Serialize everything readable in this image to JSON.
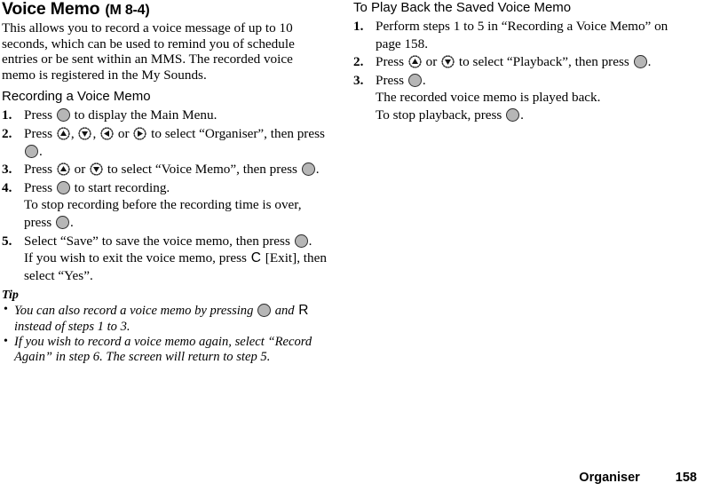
{
  "page": {
    "title": "Voice Memo",
    "title_suffix": "(M 8-4)",
    "intro": "This allows you to record a voice message of up to 10 seconds, which can be used to remind you of schedule entries or be sent within an MMS. The recorded voice memo is registered in the My Sounds."
  },
  "left_column": {
    "section_heading": "Recording a Voice Memo",
    "steps": [
      {
        "num": "1.",
        "parts": [
          {
            "t": "text",
            "v": "Press "
          },
          {
            "t": "key",
            "v": "center-key"
          },
          {
            "t": "text",
            "v": " to display the Main Menu."
          }
        ]
      },
      {
        "num": "2.",
        "parts": [
          {
            "t": "text",
            "v": "Press "
          },
          {
            "t": "key",
            "v": "up-key"
          },
          {
            "t": "text",
            "v": ", "
          },
          {
            "t": "key",
            "v": "down-key"
          },
          {
            "t": "text",
            "v": ", "
          },
          {
            "t": "key",
            "v": "left-key"
          },
          {
            "t": "text",
            "v": " or "
          },
          {
            "t": "key",
            "v": "right-key"
          },
          {
            "t": "text",
            "v": " to select “Organiser”, then press "
          },
          {
            "t": "key",
            "v": "center-key"
          },
          {
            "t": "text",
            "v": "."
          }
        ]
      },
      {
        "num": "3.",
        "parts": [
          {
            "t": "text",
            "v": "Press "
          },
          {
            "t": "key",
            "v": "up-key"
          },
          {
            "t": "text",
            "v": " or "
          },
          {
            "t": "key",
            "v": "down-key"
          },
          {
            "t": "text",
            "v": " to select “Voice Memo”, then press "
          },
          {
            "t": "key",
            "v": "center-key"
          },
          {
            "t": "text",
            "v": "."
          }
        ]
      },
      {
        "num": "4.",
        "parts": [
          {
            "t": "text",
            "v": "Press "
          },
          {
            "t": "key",
            "v": "center-key"
          },
          {
            "t": "text",
            "v": " to start recording."
          },
          {
            "t": "br"
          },
          {
            "t": "text",
            "v": "To stop recording before the recording time is over, press "
          },
          {
            "t": "key",
            "v": "center-key"
          },
          {
            "t": "text",
            "v": "."
          }
        ]
      },
      {
        "num": "5.",
        "parts": [
          {
            "t": "text",
            "v": "Select “Save” to save the voice memo, then press "
          },
          {
            "t": "key",
            "v": "center-key"
          },
          {
            "t": "text",
            "v": "."
          },
          {
            "t": "br"
          },
          {
            "t": "text",
            "v": "If you wish to exit the voice memo, press "
          },
          {
            "t": "key",
            "v": "C"
          },
          {
            "t": "text",
            "v": " [Exit], then select “Yes”."
          }
        ]
      }
    ],
    "tip_heading": "Tip",
    "tips": [
      {
        "bullet": "•",
        "parts": [
          {
            "t": "text",
            "v": "You can also record a voice memo by pressing "
          },
          {
            "t": "key",
            "v": "center-key"
          },
          {
            "t": "text",
            "v": " and "
          },
          {
            "t": "key",
            "v": "R"
          },
          {
            "t": "text",
            "v": " instead of steps 1 to 3."
          }
        ]
      },
      {
        "bullet": "•",
        "parts": [
          {
            "t": "text",
            "v": "If you wish to record a voice memo again, select “Record Again” in step 6. The screen will return to step 5."
          }
        ]
      }
    ]
  },
  "right_column": {
    "section_heading": "To Play Back the Saved Voice Memo",
    "steps": [
      {
        "num": "1.",
        "parts": [
          {
            "t": "text",
            "v": "Perform steps 1 to 5 in “Recording a Voice Memo” on page 158."
          }
        ]
      },
      {
        "num": "2.",
        "parts": [
          {
            "t": "text",
            "v": "Press "
          },
          {
            "t": "key",
            "v": "up-key"
          },
          {
            "t": "text",
            "v": " or "
          },
          {
            "t": "key",
            "v": "down-key"
          },
          {
            "t": "text",
            "v": " to select “Playback”, then press "
          },
          {
            "t": "key",
            "v": "center-key"
          },
          {
            "t": "text",
            "v": "."
          }
        ]
      },
      {
        "num": "3.",
        "parts": [
          {
            "t": "text",
            "v": "Press "
          },
          {
            "t": "key",
            "v": "center-key"
          },
          {
            "t": "text",
            "v": "."
          },
          {
            "t": "br"
          },
          {
            "t": "text",
            "v": "The recorded voice memo is played back."
          },
          {
            "t": "br"
          },
          {
            "t": "text",
            "v": "To stop playback, press "
          },
          {
            "t": "key",
            "v": "center-key"
          },
          {
            "t": "text",
            "v": "."
          }
        ]
      }
    ]
  },
  "footer": {
    "chapter": "Organiser",
    "page_number": "158"
  },
  "colors": {
    "key_fill": "#b6b6b6",
    "key_stroke": "#2b2b2b",
    "text": "#000000",
    "background": "#ffffff"
  }
}
